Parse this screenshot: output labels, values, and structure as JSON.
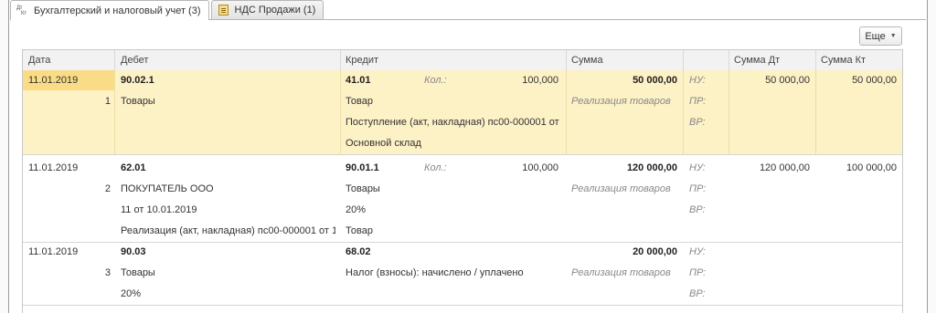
{
  "tabs": [
    {
      "label": "Бухгалтерский и налоговый учет (3)",
      "icon": "dt-kt-icon",
      "icon_text_top": "Дт",
      "icon_text_bottom": "Кт",
      "active": true
    },
    {
      "label": "НДС Продажи (1)",
      "icon": "nds-document-icon",
      "active": false
    }
  ],
  "toolbar": {
    "more_label": "Еще",
    "more_icon": "chevron-down-icon"
  },
  "columns": [
    "Дата",
    "Дебет",
    "Кредит",
    "Сумма",
    "Сумма Дт",
    "Сумма Кт"
  ],
  "entries": [
    {
      "number": "1",
      "date": "11.01.2019",
      "debit_account": "90.02.1",
      "debit_lines": [
        "Товары",
        "",
        ""
      ],
      "credit_account": "41.01",
      "qty_label": "Кол.:",
      "qty": "100,000",
      "credit_lines": [
        "Товар",
        "Поступление (акт, накладная) пс00-000001 от ...",
        "Основной склад"
      ],
      "sum": "50 000,00",
      "content": "Реализация товаров",
      "nu_label": "НУ:",
      "pr_label": "ПР:",
      "vr_label": "ВР:",
      "sum_dt": "50 000,00",
      "sum_kt": "50 000,00"
    },
    {
      "number": "2",
      "date": "11.01.2019",
      "debit_account": "62.01",
      "debit_lines": [
        "ПОКУПАТЕЛЬ ООО",
        "11 от 10.01.2019",
        "Реализация (акт, накладная) пс00-000001 от 1..."
      ],
      "credit_account": "90.01.1",
      "qty_label": "Кол.:",
      "qty": "100,000",
      "credit_lines": [
        "Товары",
        "20%",
        "Товар"
      ],
      "sum": "120 000,00",
      "content": "Реализация товаров",
      "nu_label": "НУ:",
      "pr_label": "ПР:",
      "vr_label": "ВР:",
      "sum_dt": "120 000,00",
      "sum_kt": "100 000,00"
    },
    {
      "number": "3",
      "date": "11.01.2019",
      "debit_account": "90.03",
      "debit_lines": [
        "Товары",
        "20%",
        ""
      ],
      "credit_account": "68.02",
      "qty_label": "",
      "qty": "",
      "credit_lines": [
        "Налог (взносы): начислено / уплачено",
        "",
        ""
      ],
      "sum": "20 000,00",
      "content": "Реализация товаров",
      "nu_label": "НУ:",
      "pr_label": "ПР:",
      "vr_label": "ВР:",
      "sum_dt": "",
      "sum_kt": ""
    }
  ]
}
